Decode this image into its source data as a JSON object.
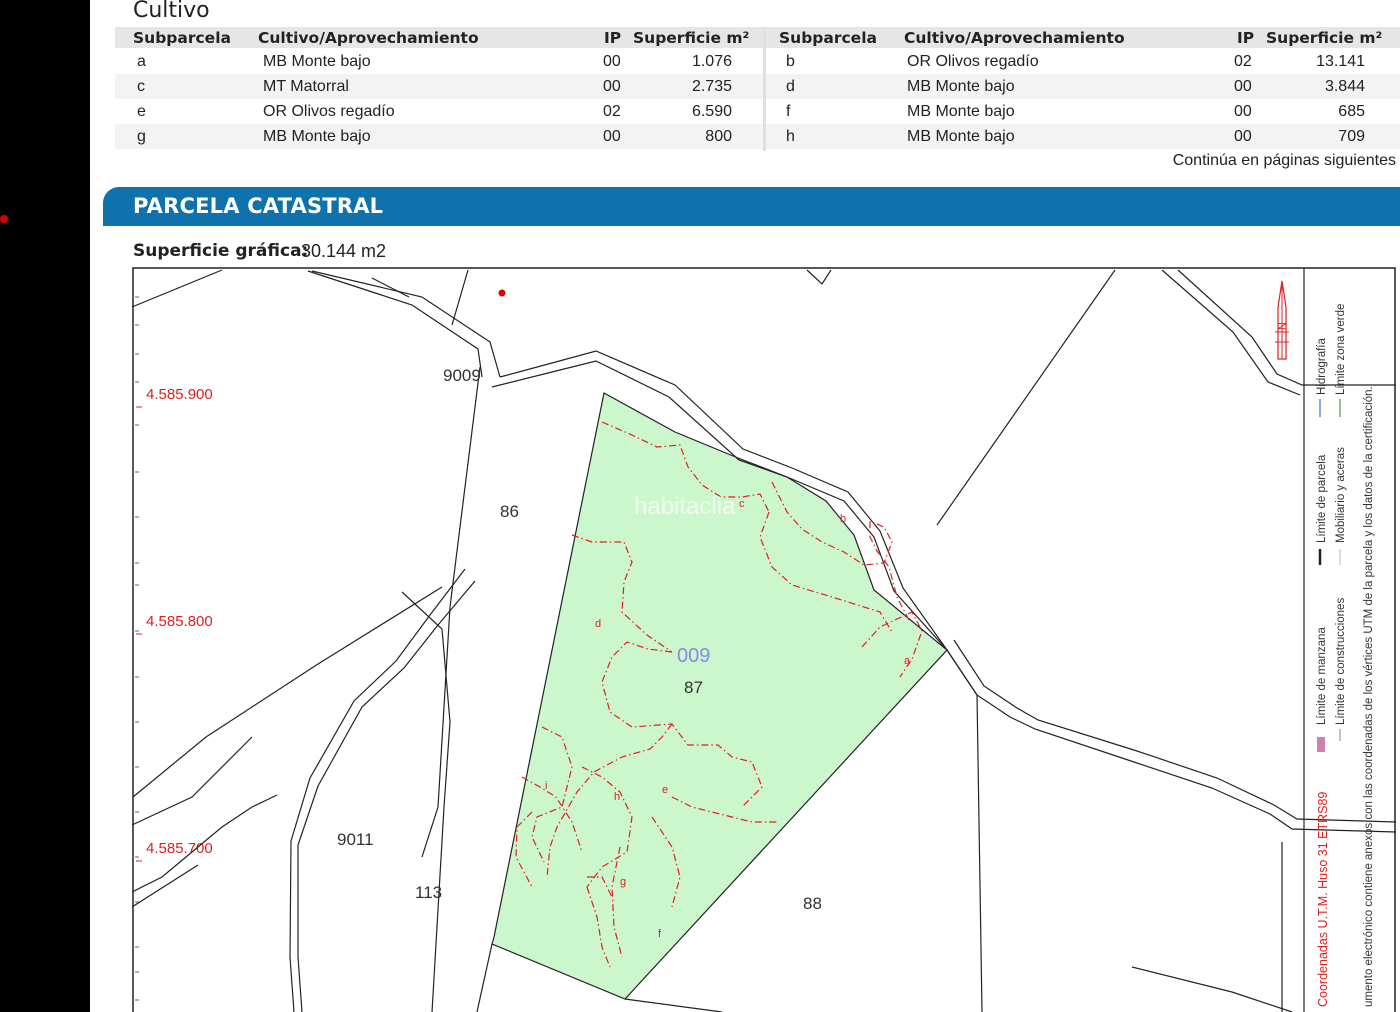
{
  "cultivo": {
    "title": "Cultivo",
    "headers": {
      "subparcela": "Subparcela",
      "cultivo": "Cultivo/Aprovechamiento",
      "ip": "IP",
      "superficie": "Superficie m²"
    },
    "left_rows": [
      {
        "sub": "a",
        "cultivo": "MB Monte bajo",
        "ip": "00",
        "sup": "1.076"
      },
      {
        "sub": "c",
        "cultivo": "MT Matorral",
        "ip": "00",
        "sup": "2.735"
      },
      {
        "sub": "e",
        "cultivo": "OR Olivos regadío",
        "ip": "02",
        "sup": "6.590"
      },
      {
        "sub": "g",
        "cultivo": "MB Monte bajo",
        "ip": "00",
        "sup": "800"
      }
    ],
    "right_rows": [
      {
        "sub": "b",
        "cultivo": "OR Olivos regadío",
        "ip": "02",
        "sup": "13.141"
      },
      {
        "sub": "d",
        "cultivo": "MB Monte bajo",
        "ip": "00",
        "sup": "3.844"
      },
      {
        "sub": "f",
        "cultivo": "MB Monte bajo",
        "ip": "00",
        "sup": "685"
      },
      {
        "sub": "h",
        "cultivo": "MB Monte bajo",
        "ip": "00",
        "sup": "709"
      }
    ],
    "continues": "Continúa en páginas siguientes"
  },
  "parcela": {
    "title": "PARCELA CATASTRAL",
    "superficie_label": "Superficie gráfica:",
    "superficie_value": "30.144 m2"
  },
  "map": {
    "y_coords": [
      "4.585.900",
      "4.585.800",
      "4.585.700"
    ],
    "polygon_labels": [
      "86",
      "87",
      "88",
      "113"
    ],
    "road_labels": [
      "9009",
      "9011"
    ],
    "poligono": "009",
    "subparcel_letters": [
      "a",
      "b",
      "c",
      "d",
      "e",
      "f",
      "g",
      "h",
      "i"
    ],
    "watermark": "habitaclia",
    "north": "N",
    "legend": {
      "coords": "Coordenadas U.T.M. Huso 31 ETRS89",
      "limite_manzana": "Límite de manzana",
      "limite_construcciones": "Límite de construcciones",
      "limite_parcela": "Límite de parcela",
      "mobiliario": "Mobiliario y aceras",
      "hidrografia": "Hidrografía",
      "zona_verde": "Límite zona verde",
      "note": "umento electrónico contiene anexos con las coordenadas de los vértices UTM de la parcela y los datos de la certificación."
    },
    "colors": {
      "parcel_fill": "#ccf6cc",
      "subparcel_line": "#e02020",
      "coord_text": "#e02020",
      "banner": "#0f72ad",
      "poligono_text": "#8a8ae8"
    }
  }
}
